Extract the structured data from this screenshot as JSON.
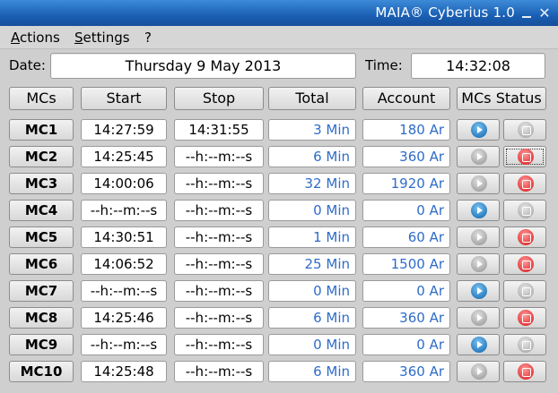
{
  "window": {
    "title": "MAIA® Cyberius 1.0",
    "close_glyph": "✕"
  },
  "menu": {
    "actions_first": "A",
    "actions_rest": "ctions",
    "settings_first": "S",
    "settings_rest": "ettings",
    "help": "?"
  },
  "date_label": "Date:",
  "date_value": "Thursday 9 May 2013",
  "time_label": "Time:",
  "time_value": "14:32:08",
  "headers": {
    "mcs": "MCs",
    "start": "Start",
    "stop": "Stop",
    "total": "Total",
    "account": "Account",
    "status": "MCs Status"
  },
  "rows": [
    {
      "mc": "MC1",
      "start": "14:27:59",
      "stop": "14:31:55",
      "total": "3 Min",
      "account": "180 Ar",
      "play": "on",
      "stopbtn": "off"
    },
    {
      "mc": "MC2",
      "start": "14:25:45",
      "stop": "--h:--m:--s",
      "total": "6 Min",
      "account": "360 Ar",
      "play": "off",
      "stopbtn": "on"
    },
    {
      "mc": "MC3",
      "start": "14:00:06",
      "stop": "--h:--m:--s",
      "total": "32 Min",
      "account": "1920 Ar",
      "play": "off",
      "stopbtn": "on"
    },
    {
      "mc": "MC4",
      "start": "--h:--m:--s",
      "stop": "--h:--m:--s",
      "total": "0 Min",
      "account": "0 Ar",
      "play": "on",
      "stopbtn": "off"
    },
    {
      "mc": "MC5",
      "start": "14:30:51",
      "stop": "--h:--m:--s",
      "total": "1 Min",
      "account": "60 Ar",
      "play": "off",
      "stopbtn": "on"
    },
    {
      "mc": "MC6",
      "start": "14:06:52",
      "stop": "--h:--m:--s",
      "total": "25 Min",
      "account": "1500 Ar",
      "play": "off",
      "stopbtn": "on"
    },
    {
      "mc": "MC7",
      "start": "--h:--m:--s",
      "stop": "--h:--m:--s",
      "total": "0 Min",
      "account": "0 Ar",
      "play": "on",
      "stopbtn": "off"
    },
    {
      "mc": "MC8",
      "start": "14:25:46",
      "stop": "--h:--m:--s",
      "total": "6 Min",
      "account": "360 Ar",
      "play": "off",
      "stopbtn": "on"
    },
    {
      "mc": "MC9",
      "start": "--h:--m:--s",
      "stop": "--h:--m:--s",
      "total": "0 Min",
      "account": "0 Ar",
      "play": "on",
      "stopbtn": "off"
    },
    {
      "mc": "MC10",
      "start": "14:25:48",
      "stop": "--h:--m:--s",
      "total": "6 Min",
      "account": "360 Ar",
      "play": "off",
      "stopbtn": "on"
    }
  ],
  "icons": {
    "play_active_color": "#2a7fc2",
    "stop_active_color": "#e53b3b"
  }
}
